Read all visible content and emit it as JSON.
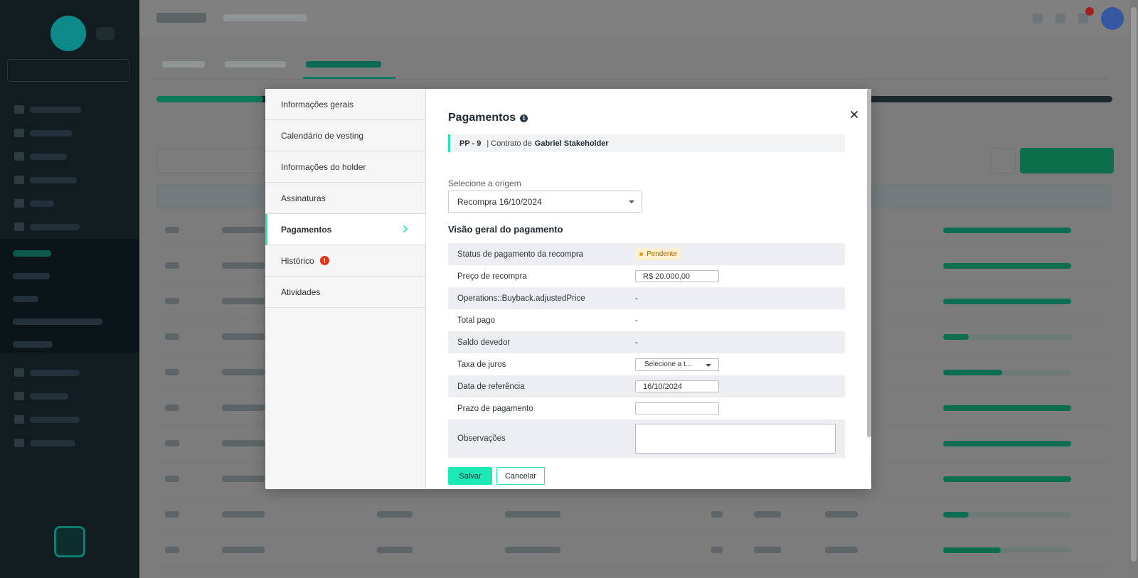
{
  "modal": {
    "nav": [
      {
        "label": "Informações gerais"
      },
      {
        "label": "Calendário de vesting"
      },
      {
        "label": "Informações do holder"
      },
      {
        "label": "Assinaturas"
      },
      {
        "label": "Pagamentos"
      },
      {
        "label": "Histórico"
      },
      {
        "label": "Atividades"
      }
    ],
    "active_nav": "Pagamentos",
    "history_alert": "!",
    "title": "Pagamentos",
    "info_icon": "i",
    "contract": {
      "code": "PP - 9",
      "separator": "| Contrato de",
      "holder": "Gabriel Stakeholder"
    },
    "origin": {
      "label": "Selecione a origem",
      "value": "Recompra 16/10/2024"
    },
    "overview_title": "Visão geral do pagamento",
    "rows": [
      {
        "label": "Status de pagamento da recompra",
        "value": "Pendente"
      },
      {
        "label": "Preço de recompra",
        "value": "R$ 20.000,00"
      },
      {
        "label": "Operations::Buyback.adjustedPrice",
        "value": "-"
      },
      {
        "label": "Total pago",
        "value": "-"
      },
      {
        "label": "Saldo devedor",
        "value": "-"
      },
      {
        "label": "Taxa de juros",
        "value": "Selecione a t..."
      },
      {
        "label": "Data de referência",
        "value": "16/10/2024"
      },
      {
        "label": "Prazo de pagamento",
        "value": ""
      },
      {
        "label": "Observações",
        "value": ""
      }
    ],
    "buttons": {
      "save": "Salvar",
      "cancel": "Cancelar"
    }
  },
  "colors": {
    "accent": "#1de9b6",
    "pending_bg": "#fdf0d1",
    "pending_text": "#a66b00",
    "alert": "#e5341a"
  },
  "icons": [
    "info-icon",
    "close-icon",
    "chevron-right-icon",
    "alert-icon",
    "caret-down-icon"
  ]
}
